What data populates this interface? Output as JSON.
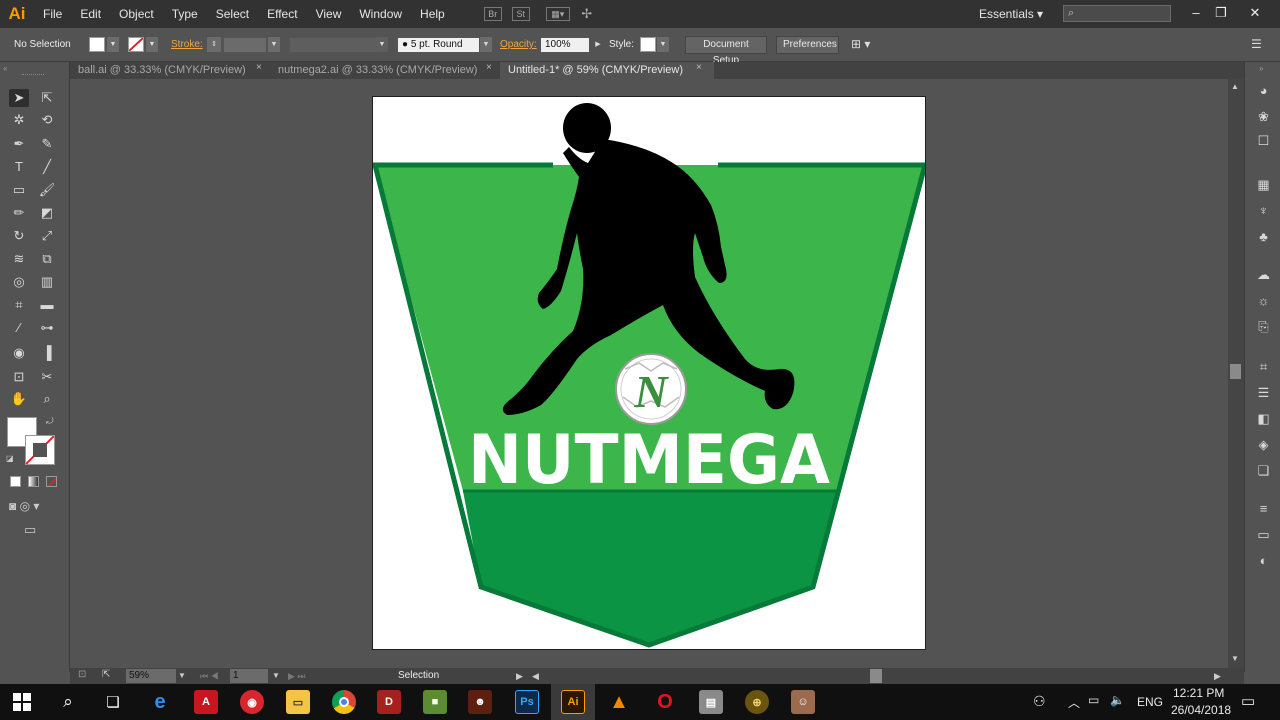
{
  "app": {
    "logo": "Ai",
    "menu": [
      "File",
      "Edit",
      "Object",
      "Type",
      "Select",
      "Effect",
      "View",
      "Window",
      "Help"
    ],
    "workspace": "Essentials",
    "window_controls": [
      "minimize-icon",
      "restore-icon",
      "close-icon"
    ]
  },
  "control_bar": {
    "selection_label": "No Selection",
    "stroke_label": "Stroke:",
    "brush_value": "5 pt. Round",
    "opacity_label": "Opacity:",
    "opacity_value": "100%",
    "style_label": "Style:",
    "document_setup": "Document Setup",
    "preferences": "Preferences"
  },
  "tabs": [
    {
      "label": "ball.ai @ 33.33% (CMYK/Preview)",
      "close": "×",
      "active": false
    },
    {
      "label": "nutmega2.ai @ 33.33% (CMYK/Preview)",
      "close": "×",
      "active": false
    },
    {
      "label": "Untitled-1* @ 59% (CMYK/Preview)",
      "close": "×",
      "active": true
    }
  ],
  "artwork": {
    "title": "NUTMEGA",
    "ball_letter": "N",
    "colors": {
      "shield_light": "#3cb54a",
      "shield_dark": "#0b9444",
      "shield_border": "#077a3a",
      "text": "#ffffff",
      "silhouette": "#000000"
    }
  },
  "status": {
    "zoom": "59%",
    "artboard_number": "1",
    "tool": "Selection"
  },
  "taskbar": {
    "lang": "ENG",
    "time": "12:21 PM",
    "date": "26/04/2018",
    "apps": [
      "start-icon",
      "search-icon",
      "task-view-icon",
      "edge-icon",
      "acrobat-icon",
      "screen-recorder-icon",
      "file-explorer-icon",
      "chrome-icon",
      "dota-icon",
      "minecraft-icon",
      "game-icon",
      "photoshop-icon",
      "illustrator-icon",
      "vlc-icon",
      "opera-icon",
      "installer-icon",
      "coin-icon",
      "photo-icon"
    ]
  },
  "accent": "#ff9a00"
}
